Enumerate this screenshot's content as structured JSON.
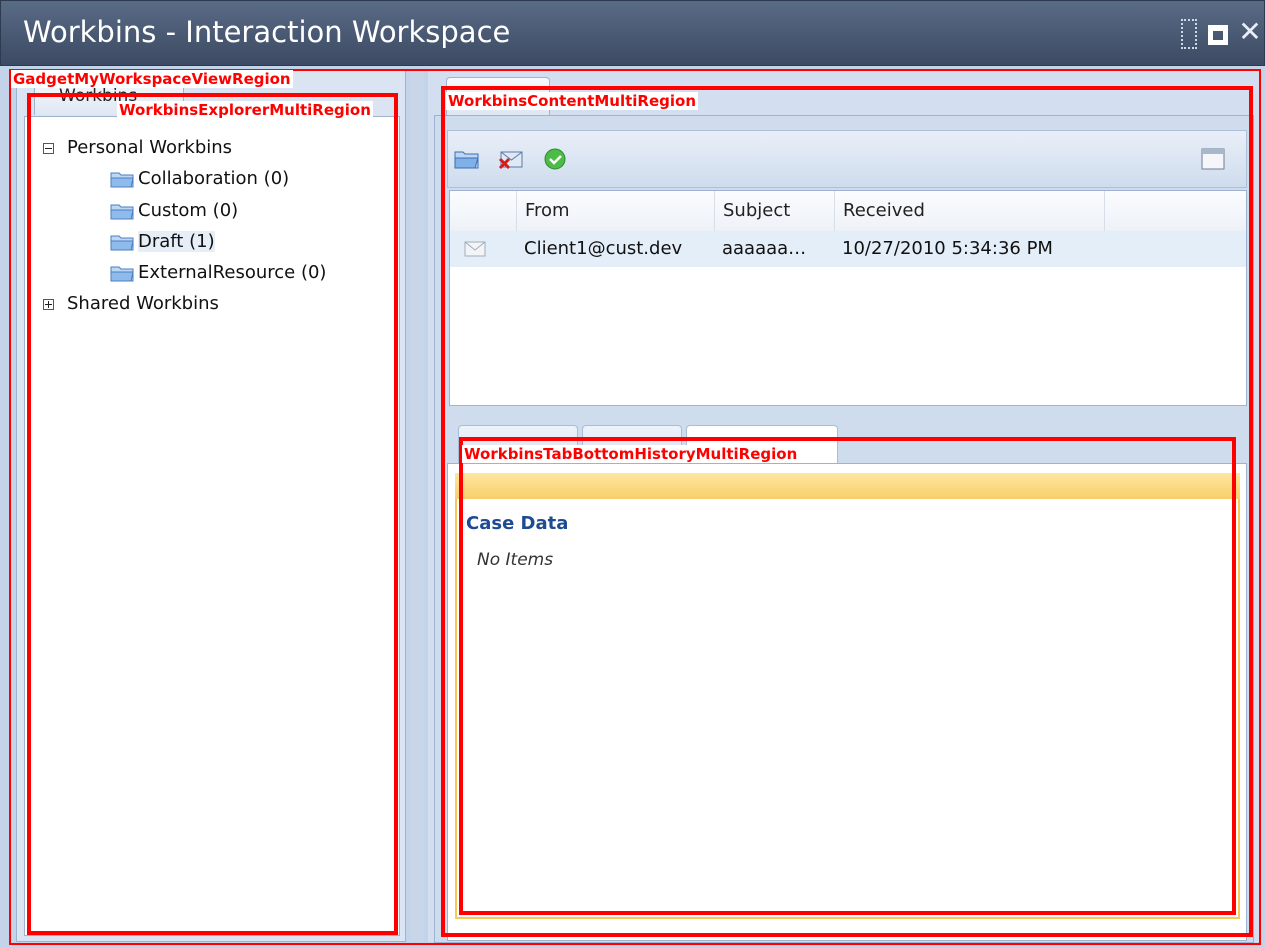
{
  "window": {
    "title": "Workbins - Interaction Workspace",
    "controls": [
      "restore-icon",
      "maximize-icon",
      "close-icon"
    ],
    "close_glyph": "✕"
  },
  "left": {
    "tab_label": "Workbins",
    "tree": {
      "personal": {
        "label": "Personal Workbins",
        "expanded": true
      },
      "items": [
        {
          "label": "Collaboration (0)"
        },
        {
          "label": "Custom (0)"
        },
        {
          "label": "Draft (1)",
          "selected": true
        },
        {
          "label": "ExternalResource (0)"
        }
      ],
      "shared": {
        "label": "Shared Workbins",
        "expanded": false
      }
    }
  },
  "right": {
    "toolbar": {
      "icons": [
        "open-folder-icon",
        "delete-email-icon",
        "mark-done-icon",
        "panel-layout-icon"
      ]
    },
    "grid": {
      "columns": [
        "From",
        "Subject",
        "Received"
      ],
      "rows": [
        {
          "icon": "email-icon",
          "from": "Client1@cust.dev",
          "subject": "aaaaaa…",
          "received": "10/27/2010 5:34:36 PM"
        }
      ]
    },
    "bottom": {
      "case_title": "Case Data",
      "empty_text": "No Items"
    }
  },
  "regions": {
    "gadget": "GadgetMyWorkspaceViewRegion",
    "explorer": "WorkbinsExplorerMultiRegion",
    "content": "WorkbinsContentMultiRegion",
    "history": "WorkbinsTabBottomHistoryMultiRegion"
  },
  "colors": {
    "region_outline": "#ff0000",
    "title_bar": "#4a5a76",
    "case_title": "#1f4b92",
    "info_bar": "#f9cf6b"
  }
}
